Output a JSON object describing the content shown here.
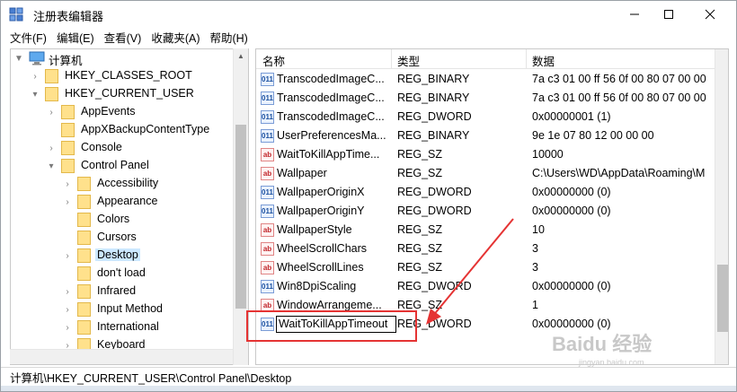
{
  "window": {
    "title": "注册表编辑器"
  },
  "menu": [
    {
      "label": "文件(F)"
    },
    {
      "label": "编辑(E)"
    },
    {
      "label": "查看(V)"
    },
    {
      "label": "收藏夹(A)"
    },
    {
      "label": "帮助(H)"
    }
  ],
  "tree": {
    "items": [
      {
        "label": "计算机",
        "arrow": "▼",
        "icon": "computer-icon"
      },
      {
        "label": "HKEY_CLASSES_ROOT",
        "arrow": "›",
        "icon": "folder-icon"
      },
      {
        "label": "HKEY_CURRENT_USER",
        "arrow": "▾",
        "icon": "folder-icon"
      },
      {
        "label": "AppEvents",
        "arrow": "›",
        "icon": "folder-icon"
      },
      {
        "label": "AppXBackupContentType",
        "arrow": "",
        "icon": "folder-icon"
      },
      {
        "label": "Console",
        "arrow": "›",
        "icon": "folder-icon"
      },
      {
        "label": "Control Panel",
        "arrow": "▾",
        "icon": "folder-icon"
      },
      {
        "label": "Accessibility",
        "arrow": "›",
        "icon": "folder-icon"
      },
      {
        "label": "Appearance",
        "arrow": "›",
        "icon": "folder-icon"
      },
      {
        "label": "Colors",
        "arrow": "",
        "icon": "folder-icon"
      },
      {
        "label": "Cursors",
        "arrow": "",
        "icon": "folder-icon"
      },
      {
        "label": "Desktop",
        "arrow": "›",
        "icon": "folder-icon",
        "selected": true
      },
      {
        "label": "don't load",
        "arrow": "",
        "icon": "folder-icon"
      },
      {
        "label": "Infrared",
        "arrow": "›",
        "icon": "folder-icon"
      },
      {
        "label": "Input Method",
        "arrow": "›",
        "icon": "folder-icon"
      },
      {
        "label": "International",
        "arrow": "›",
        "icon": "folder-icon"
      },
      {
        "label": "Keyboard",
        "arrow": "›",
        "icon": "folder-icon"
      }
    ]
  },
  "list": {
    "columns": {
      "name": "名称",
      "type": "类型",
      "data": "数据"
    },
    "rows": [
      {
        "icon": "binary-value-icon",
        "name": "TranscodedImageC...",
        "type": "REG_BINARY",
        "data": "7a c3 01 00 ff 56 0f 00 80 07 00 00"
      },
      {
        "icon": "binary-value-icon",
        "name": "TranscodedImageC...",
        "type": "REG_BINARY",
        "data": "7a c3 01 00 ff 56 0f 00 80 07 00 00"
      },
      {
        "icon": "binary-value-icon",
        "name": "TranscodedImageC...",
        "type": "REG_DWORD",
        "data": "0x00000001 (1)"
      },
      {
        "icon": "binary-value-icon",
        "name": "UserPreferencesMa...",
        "type": "REG_BINARY",
        "data": "9e 1e 07 80 12 00 00 00"
      },
      {
        "icon": "string-value-icon",
        "name": "WaitToKillAppTime...",
        "type": "REG_SZ",
        "data": "10000"
      },
      {
        "icon": "string-value-icon",
        "name": "Wallpaper",
        "type": "REG_SZ",
        "data": "C:\\Users\\WD\\AppData\\Roaming\\M"
      },
      {
        "icon": "binary-value-icon",
        "name": "WallpaperOriginX",
        "type": "REG_DWORD",
        "data": "0x00000000 (0)"
      },
      {
        "icon": "binary-value-icon",
        "name": "WallpaperOriginY",
        "type": "REG_DWORD",
        "data": "0x00000000 (0)"
      },
      {
        "icon": "string-value-icon",
        "name": "WallpaperStyle",
        "type": "REG_SZ",
        "data": "10"
      },
      {
        "icon": "string-value-icon",
        "name": "WheelScrollChars",
        "type": "REG_SZ",
        "data": "3"
      },
      {
        "icon": "string-value-icon",
        "name": "WheelScrollLines",
        "type": "REG_SZ",
        "data": "3"
      },
      {
        "icon": "binary-value-icon",
        "name": "Win8DpiScaling",
        "type": "REG_DWORD",
        "data": "0x00000000 (0)"
      },
      {
        "icon": "string-value-icon",
        "name": "WindowArrangeme...",
        "type": "REG_SZ",
        "data": "1"
      },
      {
        "icon": "binary-value-icon",
        "name": "",
        "type": "REG_DWORD",
        "data": "0x00000000 (0)",
        "editing": true,
        "edit_value": "WaitToKillAppTimeout"
      }
    ]
  },
  "statusbar": {
    "path": "计算机\\HKEY_CURRENT_USER\\Control Panel\\Desktop"
  },
  "watermark": {
    "text": "Baidu 经验",
    "sub": "jingyan.baidu.com"
  },
  "colors": {
    "selection": "#cce8ff",
    "annotation": "#e53333"
  }
}
